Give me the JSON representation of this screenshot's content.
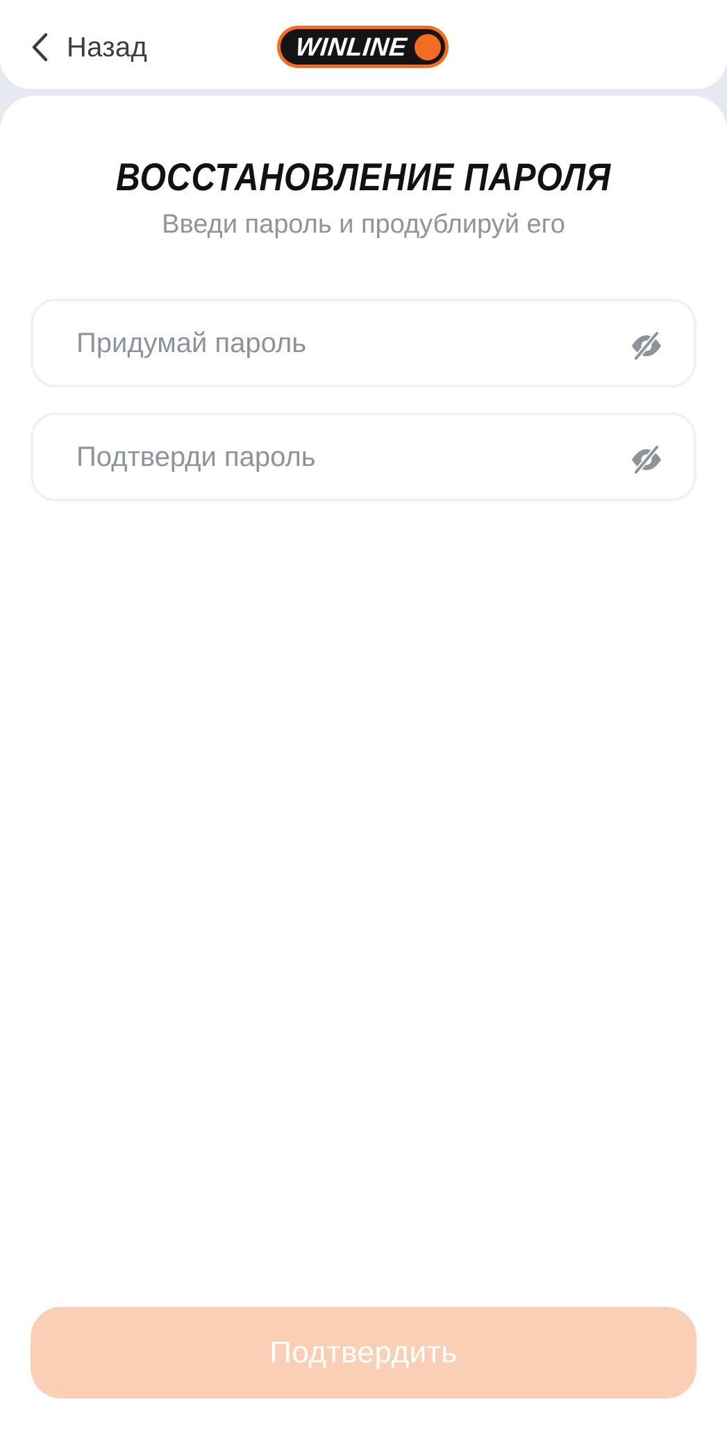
{
  "header": {
    "back_label": "Назад",
    "logo_text": "WINLINE",
    "brand_color": "#f36c21"
  },
  "main": {
    "title": "ВОССТАНОВЛЕНИЕ ПАРОЛЯ",
    "subtitle": "Введи пароль и продублируй его",
    "fields": [
      {
        "placeholder": "Придумай пароль",
        "value": "",
        "icon": "eye-off-icon"
      },
      {
        "placeholder": "Подтверди пароль",
        "value": "",
        "icon": "eye-off-icon"
      }
    ],
    "submit_label": "Подтвердить"
  }
}
